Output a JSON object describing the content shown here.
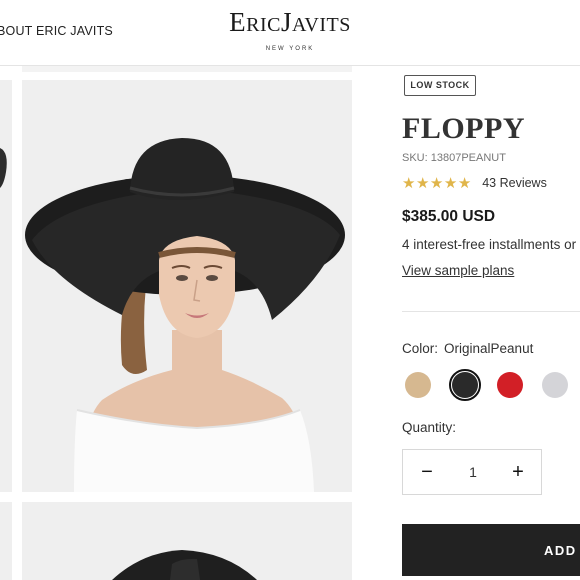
{
  "header": {
    "nav_link": "BOUT ERIC JAVITS",
    "logo_main": "EricJavits",
    "logo_sub": "NEW YORK"
  },
  "product": {
    "stock_badge": "LOW STOCK",
    "title": "FLOPPY",
    "sku": "SKU: 13807PEANUT",
    "rating_stars": 5,
    "reviews": "43 Reviews",
    "price": "$385.00 USD",
    "installments": "4 interest-free installments or",
    "sample_plans_link": "View sample plans",
    "color_label": "Color:",
    "color_value": "OriginalPeanut",
    "swatches": [
      {
        "name": "peanut",
        "color": "#d6b890",
        "selected": false
      },
      {
        "name": "black",
        "color": "#2a2a2a",
        "selected": true
      },
      {
        "name": "red",
        "color": "#d21f26",
        "selected": false
      },
      {
        "name": "silver",
        "color": "#d4d4d8",
        "selected": false
      }
    ],
    "quantity_label": "Quantity:",
    "quantity_value": "1",
    "minus_symbol": "−",
    "plus_symbol": "+",
    "add_button": "ADD TO CART"
  },
  "colors": {
    "star": "#e0b54a",
    "button_bg": "#222222",
    "image_bg": "#efefef"
  },
  "icons": {
    "zoom": "magnifier-icon",
    "star": "star-icon"
  }
}
